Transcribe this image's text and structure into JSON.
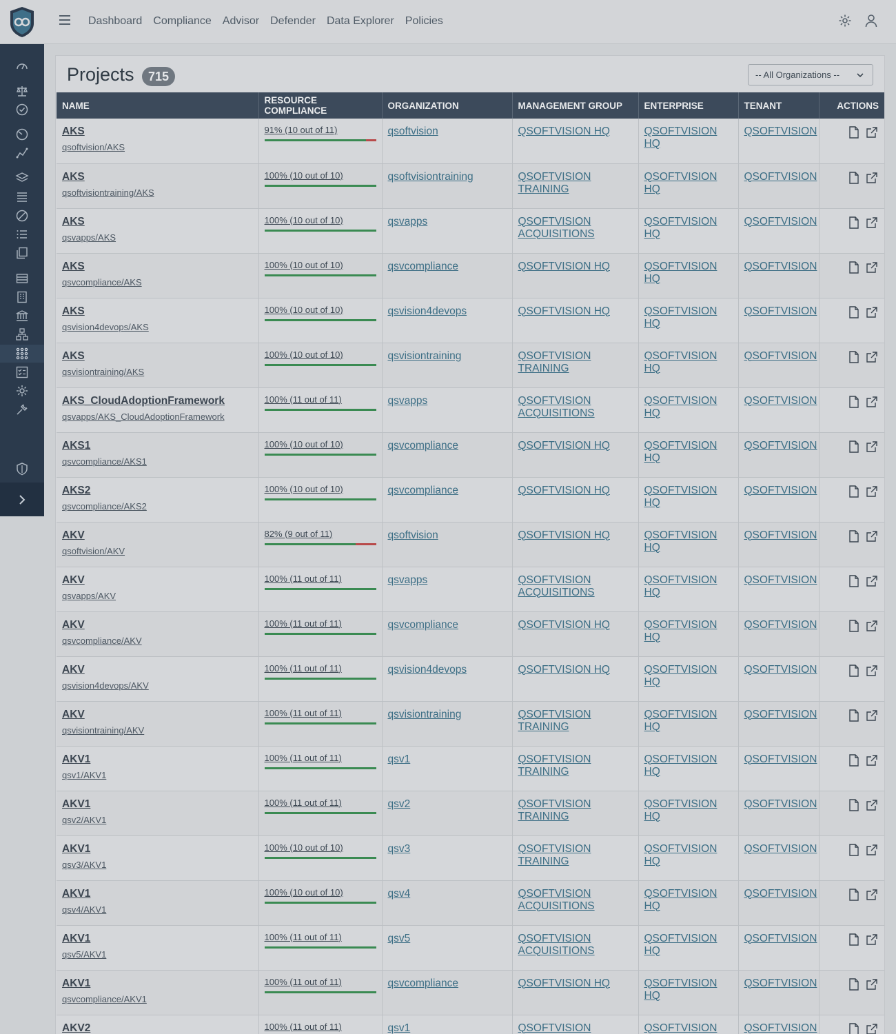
{
  "nav": {
    "items": [
      "Dashboard",
      "Compliance",
      "Advisor",
      "Defender",
      "Data Explorer",
      "Policies"
    ]
  },
  "page": {
    "title": "Projects",
    "count": "715",
    "org_filter": "-- All Organizations --"
  },
  "table": {
    "columns": [
      "NAME",
      "RESOURCE COMPLIANCE",
      "ORGANIZATION",
      "MANAGEMENT GROUP",
      "ENTERPRISE",
      "TENANT",
      "ACTIONS"
    ],
    "rows": [
      {
        "name": "AKS",
        "path": "qsoftvision/AKS",
        "compliance": "91% (10 out of 11)",
        "percent": 91,
        "org": "qsoftvision",
        "mgmt": "QSOFTVISION HQ",
        "enterprise": "QSOFTVISION HQ",
        "tenant": "QSOFTVISION"
      },
      {
        "name": "AKS",
        "path": "qsoftvisiontraining/AKS",
        "compliance": "100% (10 out of 10)",
        "percent": 100,
        "org": "qsoftvisiontraining",
        "mgmt": "QSOFTVISION TRAINING",
        "enterprise": "QSOFTVISION HQ",
        "tenant": "QSOFTVISION"
      },
      {
        "name": "AKS",
        "path": "qsvapps/AKS",
        "compliance": "100% (10 out of 10)",
        "percent": 100,
        "org": "qsvapps",
        "mgmt": "QSOFTVISION ACQUISITIONS",
        "enterprise": "QSOFTVISION HQ",
        "tenant": "QSOFTVISION"
      },
      {
        "name": "AKS",
        "path": "qsvcompliance/AKS",
        "compliance": "100% (10 out of 10)",
        "percent": 100,
        "org": "qsvcompliance",
        "mgmt": "QSOFTVISION HQ",
        "enterprise": "QSOFTVISION HQ",
        "tenant": "QSOFTVISION"
      },
      {
        "name": "AKS",
        "path": "qsvision4devops/AKS",
        "compliance": "100% (10 out of 10)",
        "percent": 100,
        "org": "qsvision4devops",
        "mgmt": "QSOFTVISION HQ",
        "enterprise": "QSOFTVISION HQ",
        "tenant": "QSOFTVISION"
      },
      {
        "name": "AKS",
        "path": "qsvisiontraining/AKS",
        "compliance": "100% (10 out of 10)",
        "percent": 100,
        "org": "qsvisiontraining",
        "mgmt": "QSOFTVISION TRAINING",
        "enterprise": "QSOFTVISION HQ",
        "tenant": "QSOFTVISION"
      },
      {
        "name": "AKS_CloudAdoptionFramework",
        "path": "qsvapps/AKS_CloudAdoptionFramework",
        "compliance": "100% (11 out of 11)",
        "percent": 100,
        "org": "qsvapps",
        "mgmt": "QSOFTVISION ACQUISITIONS",
        "enterprise": "QSOFTVISION HQ",
        "tenant": "QSOFTVISION"
      },
      {
        "name": "AKS1",
        "path": "qsvcompliance/AKS1",
        "compliance": "100% (10 out of 10)",
        "percent": 100,
        "org": "qsvcompliance",
        "mgmt": "QSOFTVISION HQ",
        "enterprise": "QSOFTVISION HQ",
        "tenant": "QSOFTVISION"
      },
      {
        "name": "AKS2",
        "path": "qsvcompliance/AKS2",
        "compliance": "100% (10 out of 10)",
        "percent": 100,
        "org": "qsvcompliance",
        "mgmt": "QSOFTVISION HQ",
        "enterprise": "QSOFTVISION HQ",
        "tenant": "QSOFTVISION"
      },
      {
        "name": "AKV",
        "path": "qsoftvision/AKV",
        "compliance": "82% (9 out of 11)",
        "percent": 82,
        "org": "qsoftvision",
        "mgmt": "QSOFTVISION HQ",
        "enterprise": "QSOFTVISION HQ",
        "tenant": "QSOFTVISION"
      },
      {
        "name": "AKV",
        "path": "qsvapps/AKV",
        "compliance": "100% (11 out of 11)",
        "percent": 100,
        "org": "qsvapps",
        "mgmt": "QSOFTVISION ACQUISITIONS",
        "enterprise": "QSOFTVISION HQ",
        "tenant": "QSOFTVISION"
      },
      {
        "name": "AKV",
        "path": "qsvcompliance/AKV",
        "compliance": "100% (11 out of 11)",
        "percent": 100,
        "org": "qsvcompliance",
        "mgmt": "QSOFTVISION HQ",
        "enterprise": "QSOFTVISION HQ",
        "tenant": "QSOFTVISION"
      },
      {
        "name": "AKV",
        "path": "qsvision4devops/AKV",
        "compliance": "100% (11 out of 11)",
        "percent": 100,
        "org": "qsvision4devops",
        "mgmt": "QSOFTVISION HQ",
        "enterprise": "QSOFTVISION HQ",
        "tenant": "QSOFTVISION"
      },
      {
        "name": "AKV",
        "path": "qsvisiontraining/AKV",
        "compliance": "100% (11 out of 11)",
        "percent": 100,
        "org": "qsvisiontraining",
        "mgmt": "QSOFTVISION TRAINING",
        "enterprise": "QSOFTVISION HQ",
        "tenant": "QSOFTVISION"
      },
      {
        "name": "AKV1",
        "path": "qsv1/AKV1",
        "compliance": "100% (11 out of 11)",
        "percent": 100,
        "org": "qsv1",
        "mgmt": "QSOFTVISION TRAINING",
        "enterprise": "QSOFTVISION HQ",
        "tenant": "QSOFTVISION"
      },
      {
        "name": "AKV1",
        "path": "qsv2/AKV1",
        "compliance": "100% (11 out of 11)",
        "percent": 100,
        "org": "qsv2",
        "mgmt": "QSOFTVISION TRAINING",
        "enterprise": "QSOFTVISION HQ",
        "tenant": "QSOFTVISION"
      },
      {
        "name": "AKV1",
        "path": "qsv3/AKV1",
        "compliance": "100% (10 out of 10)",
        "percent": 100,
        "org": "qsv3",
        "mgmt": "QSOFTVISION TRAINING",
        "enterprise": "QSOFTVISION HQ",
        "tenant": "QSOFTVISION"
      },
      {
        "name": "AKV1",
        "path": "qsv4/AKV1",
        "compliance": "100% (10 out of 10)",
        "percent": 100,
        "org": "qsv4",
        "mgmt": "QSOFTVISION ACQUISITIONS",
        "enterprise": "QSOFTVISION HQ",
        "tenant": "QSOFTVISION"
      },
      {
        "name": "AKV1",
        "path": "qsv5/AKV1",
        "compliance": "100% (11 out of 11)",
        "percent": 100,
        "org": "qsv5",
        "mgmt": "QSOFTVISION ACQUISITIONS",
        "enterprise": "QSOFTVISION HQ",
        "tenant": "QSOFTVISION"
      },
      {
        "name": "AKV1",
        "path": "qsvcompliance/AKV1",
        "compliance": "100% (11 out of 11)",
        "percent": 100,
        "org": "qsvcompliance",
        "mgmt": "QSOFTVISION HQ",
        "enterprise": "QSOFTVISION HQ",
        "tenant": "QSOFTVISION"
      },
      {
        "name": "AKV2",
        "path": "",
        "compliance": "100% (11 out of 11)",
        "percent": 100,
        "org": "qsv1",
        "mgmt": "QSOFTVISION",
        "enterprise": "QSOFTVISION HQ",
        "tenant": "QSOFTVISION"
      }
    ]
  },
  "colors": {
    "sidebar": "#2b3a4c",
    "table_header": "#3c4a5b",
    "bar_pass": "#3a8a52",
    "bar_fail": "#b84a4a",
    "link": "#3c6e85"
  },
  "icons": {
    "sidebar": [
      "dashboard-gauge-icon",
      "scale-icon",
      "check-circle-icon",
      "advisor-icon",
      "chart-line-icon",
      "layers-icon",
      "list-icon",
      "ban-icon",
      "ordered-list-icon",
      "copy-icon",
      "storage-icon",
      "building-icon",
      "bank-icon",
      "hierarchy-icon",
      "apps-grid-icon",
      "checklist-icon",
      "gear-icon",
      "tools-icon",
      "shield-icon"
    ],
    "row_actions": [
      "document-icon",
      "external-link-icon"
    ]
  }
}
